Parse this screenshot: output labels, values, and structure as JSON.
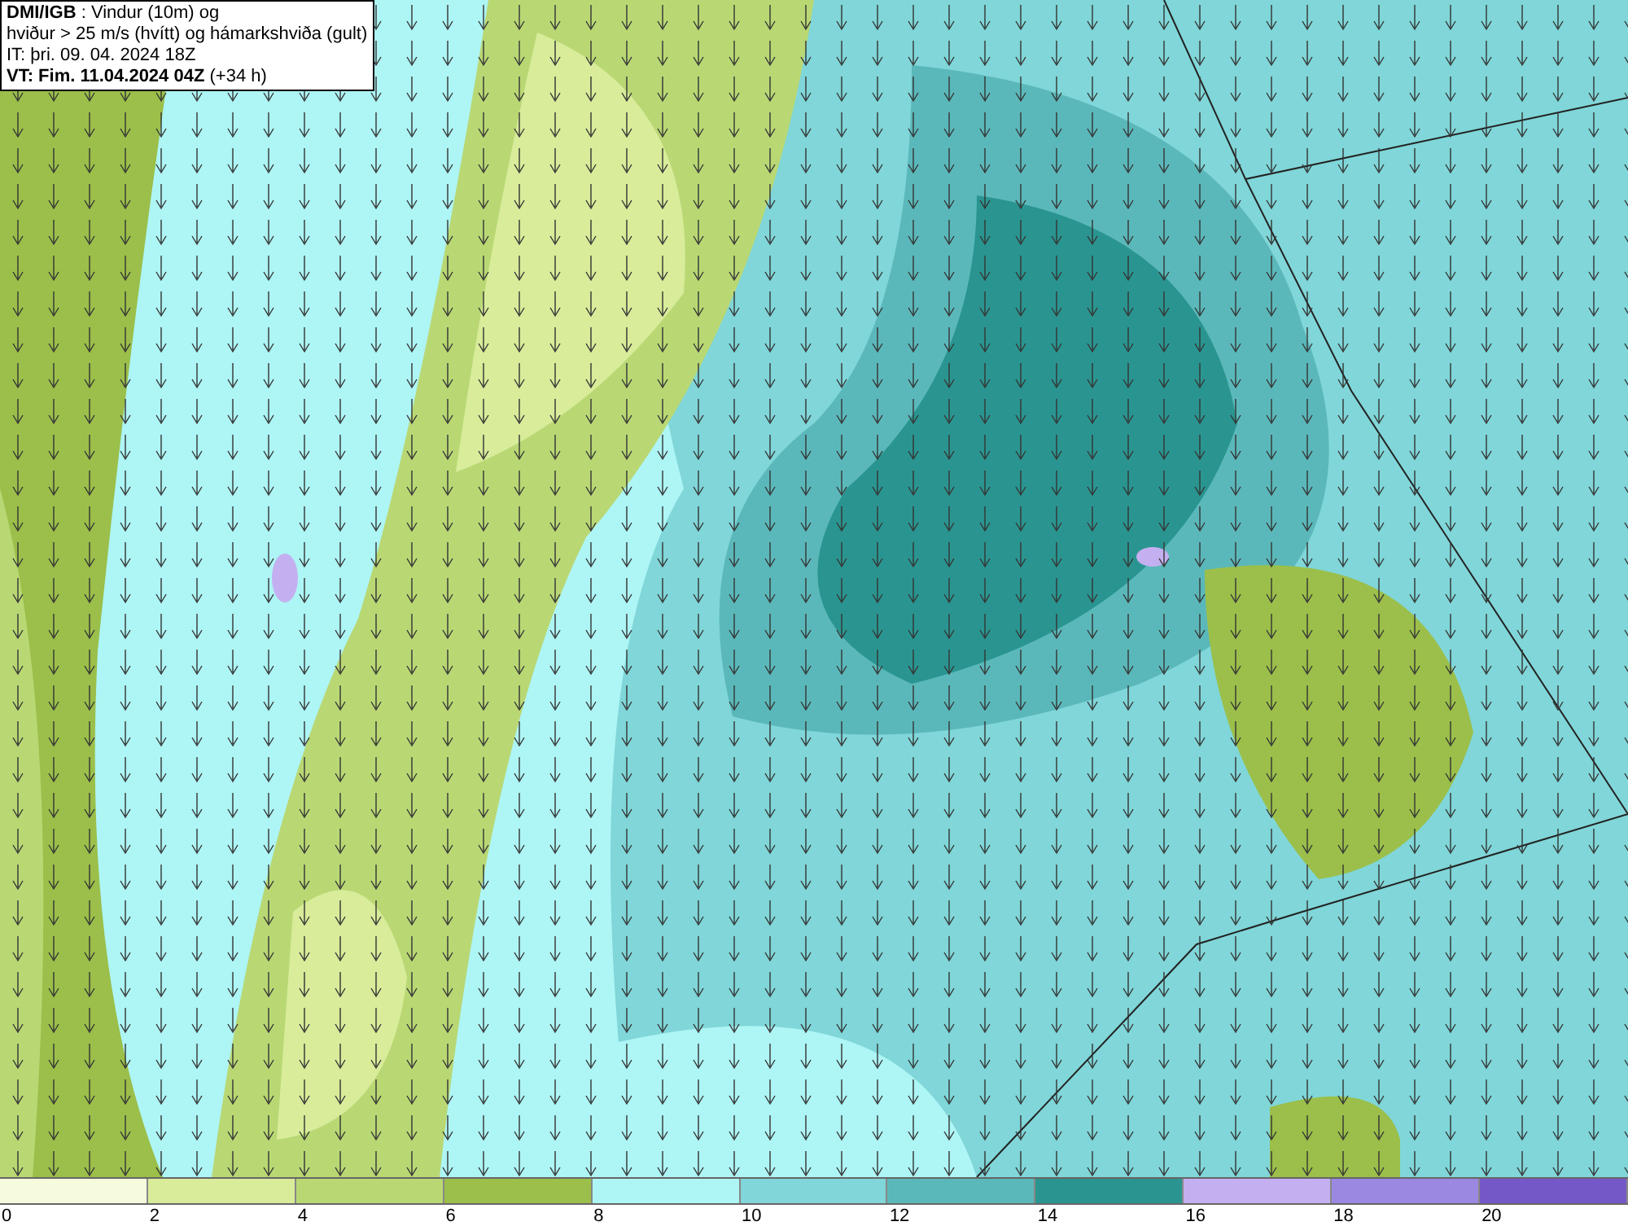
{
  "title_box": {
    "lines": [
      "**DMI/IGB** : Vindur (10m) og",
      "hviður > 25 m/s (hvítt) og hámarkshviða (gult)",
      "IT: þri. 09. 04. 2024 18Z",
      "**VT: Fim. 11.04.2024 04Z** (+34 h)"
    ]
  },
  "legend": {
    "bins": [
      {
        "color": "#f5fbdc"
      },
      {
        "color": "#d8ec9a"
      },
      {
        "color": "#b9d874"
      },
      {
        "color": "#9bbf4a"
      },
      {
        "color": "#aef5f5"
      },
      {
        "color": "#80d6d8"
      },
      {
        "color": "#5bb8ba"
      },
      {
        "color": "#2a9590"
      },
      {
        "color": "#c4b0f0"
      },
      {
        "color": "#9b88e0"
      },
      {
        "color": "#7558c8"
      }
    ],
    "ticks": [
      "0",
      "2",
      "4",
      "6",
      "8",
      "10",
      "12",
      "14",
      "16",
      "18",
      "20"
    ]
  }
}
